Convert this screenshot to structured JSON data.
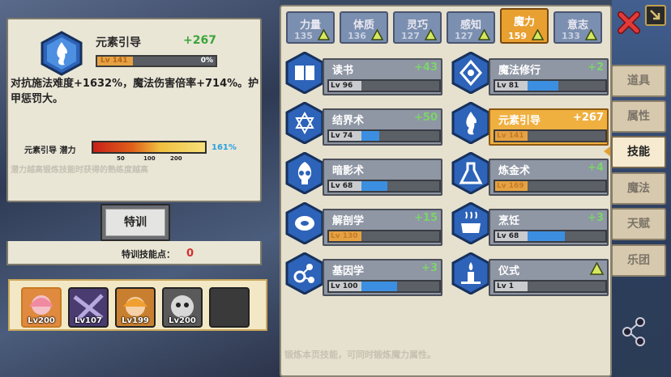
{
  "detail": {
    "title": "元素引导",
    "value": "+267",
    "level": "Lv 141",
    "percent": "0%",
    "description": "对抗施法难度+1632%，魔法伤害倍率+714%。护甲惩罚大。",
    "potential_label": "元素引导 潜力",
    "potential_ticks": [
      "50",
      "100",
      "200"
    ],
    "potential_pct": "161%",
    "potential_note": "潜力越高锻炼技能时获得的熟练度越高"
  },
  "training": {
    "button_label": "特训",
    "points_label": "特训技能点：",
    "points_value": "0"
  },
  "characters": [
    {
      "level": "Lv200",
      "color": "#e08a40"
    },
    {
      "level": "Lv107",
      "color": "#5a4a8a"
    },
    {
      "level": "Lv199",
      "color": "#d88a3a"
    },
    {
      "level": "Lv200",
      "color": "#6a6a6a"
    },
    {
      "level": "",
      "color": "#444"
    }
  ],
  "stats": [
    {
      "name": "力量",
      "value": "135",
      "active": false
    },
    {
      "name": "体质",
      "value": "136",
      "active": false
    },
    {
      "name": "灵巧",
      "value": "127",
      "active": false
    },
    {
      "name": "感知",
      "value": "127",
      "active": false
    },
    {
      "name": "魔力",
      "value": "159",
      "active": true
    },
    {
      "name": "意志",
      "value": "133",
      "active": false
    }
  ],
  "skills": [
    {
      "name": "读书",
      "gain": "+43",
      "level": "Lv 96",
      "progress": 0,
      "icon": "book-icon",
      "highlight": false,
      "orange": false
    },
    {
      "name": "魔法修行",
      "gain": "+2",
      "level": "Lv 81",
      "progress": 0.38,
      "icon": "magic-rune-icon",
      "highlight": false,
      "orange": false
    },
    {
      "name": "结界术",
      "gain": "+50",
      "level": "Lv 74",
      "progress": 0.23,
      "icon": "hexagram-icon",
      "highlight": false,
      "orange": false
    },
    {
      "name": "元素引导",
      "gain": "+267",
      "level": "Lv 141",
      "progress": 0,
      "icon": "element-flame-icon",
      "highlight": true,
      "orange": true
    },
    {
      "name": "暗影术",
      "gain": "",
      "level": "Lv 68",
      "progress": 0.33,
      "icon": "skull-icon",
      "highlight": false,
      "orange": false
    },
    {
      "name": "炼金术",
      "gain": "+4",
      "level": "Lv 169",
      "progress": 0,
      "icon": "flask-icon",
      "highlight": false,
      "orange": true
    },
    {
      "name": "解剖学",
      "gain": "+15",
      "level": "Lv 130",
      "progress": 0,
      "icon": "meat-icon",
      "highlight": false,
      "orange": true
    },
    {
      "name": "烹饪",
      "gain": "+3",
      "level": "Lv 68",
      "progress": 0.47,
      "icon": "cooking-pot-icon",
      "highlight": false,
      "orange": false
    },
    {
      "name": "基因学",
      "gain": "+3",
      "level": "Lv 100",
      "progress": 0.44,
      "icon": "gene-icon",
      "highlight": false,
      "orange": false
    },
    {
      "name": "仪式",
      "gain": "",
      "level": "Lv 1",
      "progress": 0,
      "icon": "ritual-candle-icon",
      "highlight": false,
      "orange": false
    }
  ],
  "footnote": "锻炼本页技能，可同时锻炼魔力属性。",
  "sidetabs": [
    {
      "label": "道具",
      "active": false
    },
    {
      "label": "属性",
      "active": false
    },
    {
      "label": "技能",
      "active": true
    },
    {
      "label": "魔法",
      "active": false
    },
    {
      "label": "天赋",
      "active": false
    },
    {
      "label": "乐团",
      "active": false
    }
  ]
}
